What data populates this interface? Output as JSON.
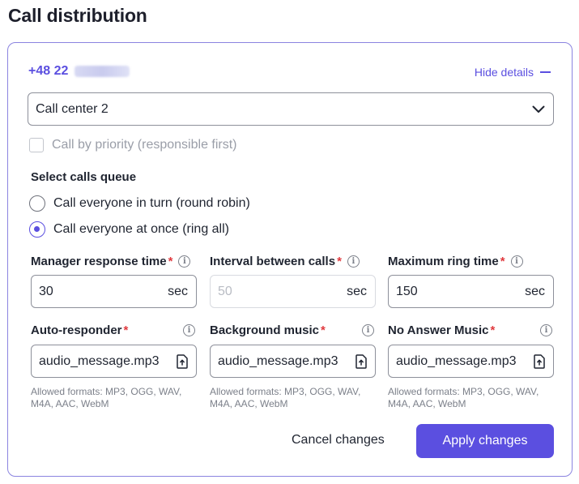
{
  "page": {
    "title": "Call distribution"
  },
  "card": {
    "phone_prefix": "+48 22",
    "hide_details_label": "Hide details",
    "select": {
      "value": "Call center 2",
      "icon": "chevron-down-icon"
    },
    "priority_checkbox": {
      "label": "Call by priority (responsible first)",
      "checked": false,
      "disabled": true
    },
    "queue": {
      "label": "Select calls queue",
      "options": [
        {
          "label": "Call everyone in turn (round robin)",
          "selected": false
        },
        {
          "label": "Call everyone at once (ring all)",
          "selected": true
        }
      ]
    },
    "timing_fields": [
      {
        "label": "Manager response time",
        "value": "30",
        "unit": "sec",
        "disabled": false
      },
      {
        "label": "Interval between calls",
        "value": "50",
        "unit": "sec",
        "disabled": true
      },
      {
        "label": "Maximum ring time",
        "value": "150",
        "unit": "sec",
        "disabled": false
      }
    ],
    "audio_fields": [
      {
        "label": "Auto-responder",
        "value": "audio_message.mp3"
      },
      {
        "label": "Background music",
        "value": "audio_message.mp3"
      },
      {
        "label": "No Answer Music",
        "value": "audio_message.mp3"
      }
    ],
    "required_mark": "*",
    "info_glyph": "i",
    "allowed_formats_hint": "Allowed formats: MP3, OGG, WAV, M4A, AAC, WebM",
    "buttons": {
      "cancel": "Cancel changes",
      "apply": "Apply changes"
    }
  },
  "colors": {
    "accent": "#5b4fe0",
    "required": "#e0393e",
    "border": "#8b84e0"
  }
}
